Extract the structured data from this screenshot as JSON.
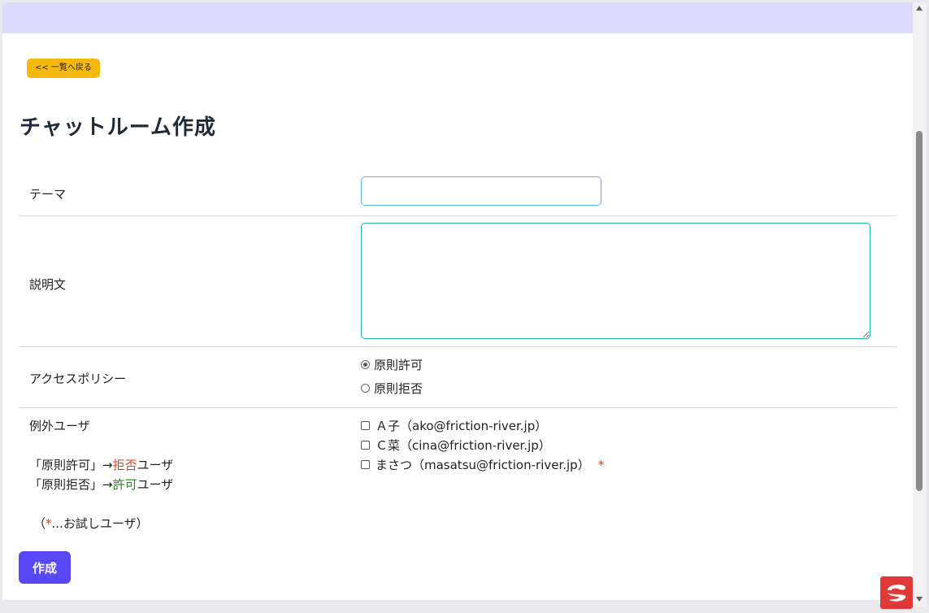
{
  "colors": {
    "top_band": "#dcdaff",
    "back_button": "#f5b80f",
    "create_button": "#5848f5",
    "required_mark": "#e03e1a",
    "deny_text": "#e03e1a",
    "allow_text": "#1a8a1a"
  },
  "nav": {
    "back_label": "<< 一覧へ戻る"
  },
  "page": {
    "title": "チャットルーム作成"
  },
  "form": {
    "theme": {
      "label": "テーマ",
      "value": "",
      "placeholder": ""
    },
    "description": {
      "label": "説明文",
      "value": "",
      "placeholder": ""
    },
    "access_policy": {
      "label": "アクセスポリシー",
      "options": [
        {
          "label": "原則許可",
          "checked": true
        },
        {
          "label": "原則拒否",
          "checked": false
        }
      ]
    },
    "exception_users": {
      "label": "例外ユーザ",
      "note1_prefix": "「原則許可」→",
      "note1_highlight": "拒否",
      "note1_suffix": "ユーザ",
      "note2_prefix": "「原則拒否」→",
      "note2_highlight": "許可",
      "note2_suffix": "ユーザ",
      "trial_prefix": "（",
      "trial_mark": "*",
      "trial_suffix": "...お試しユーザ）",
      "users": [
        {
          "label": "Ａ子（ako@friction-river.jp）",
          "checked": false,
          "trial": false
        },
        {
          "label": "Ｃ菜（cina@friction-river.jp）",
          "checked": false,
          "trial": false
        },
        {
          "label": "まさつ（masatsu@friction-river.jp）",
          "checked": false,
          "trial": true,
          "mark": "*"
        }
      ]
    }
  },
  "actions": {
    "create_label": "作成"
  },
  "icons": {
    "scroll_up": "triangle-up-icon",
    "scroll_down": "triangle-down-icon",
    "corner_logo": "app-logo-icon"
  }
}
